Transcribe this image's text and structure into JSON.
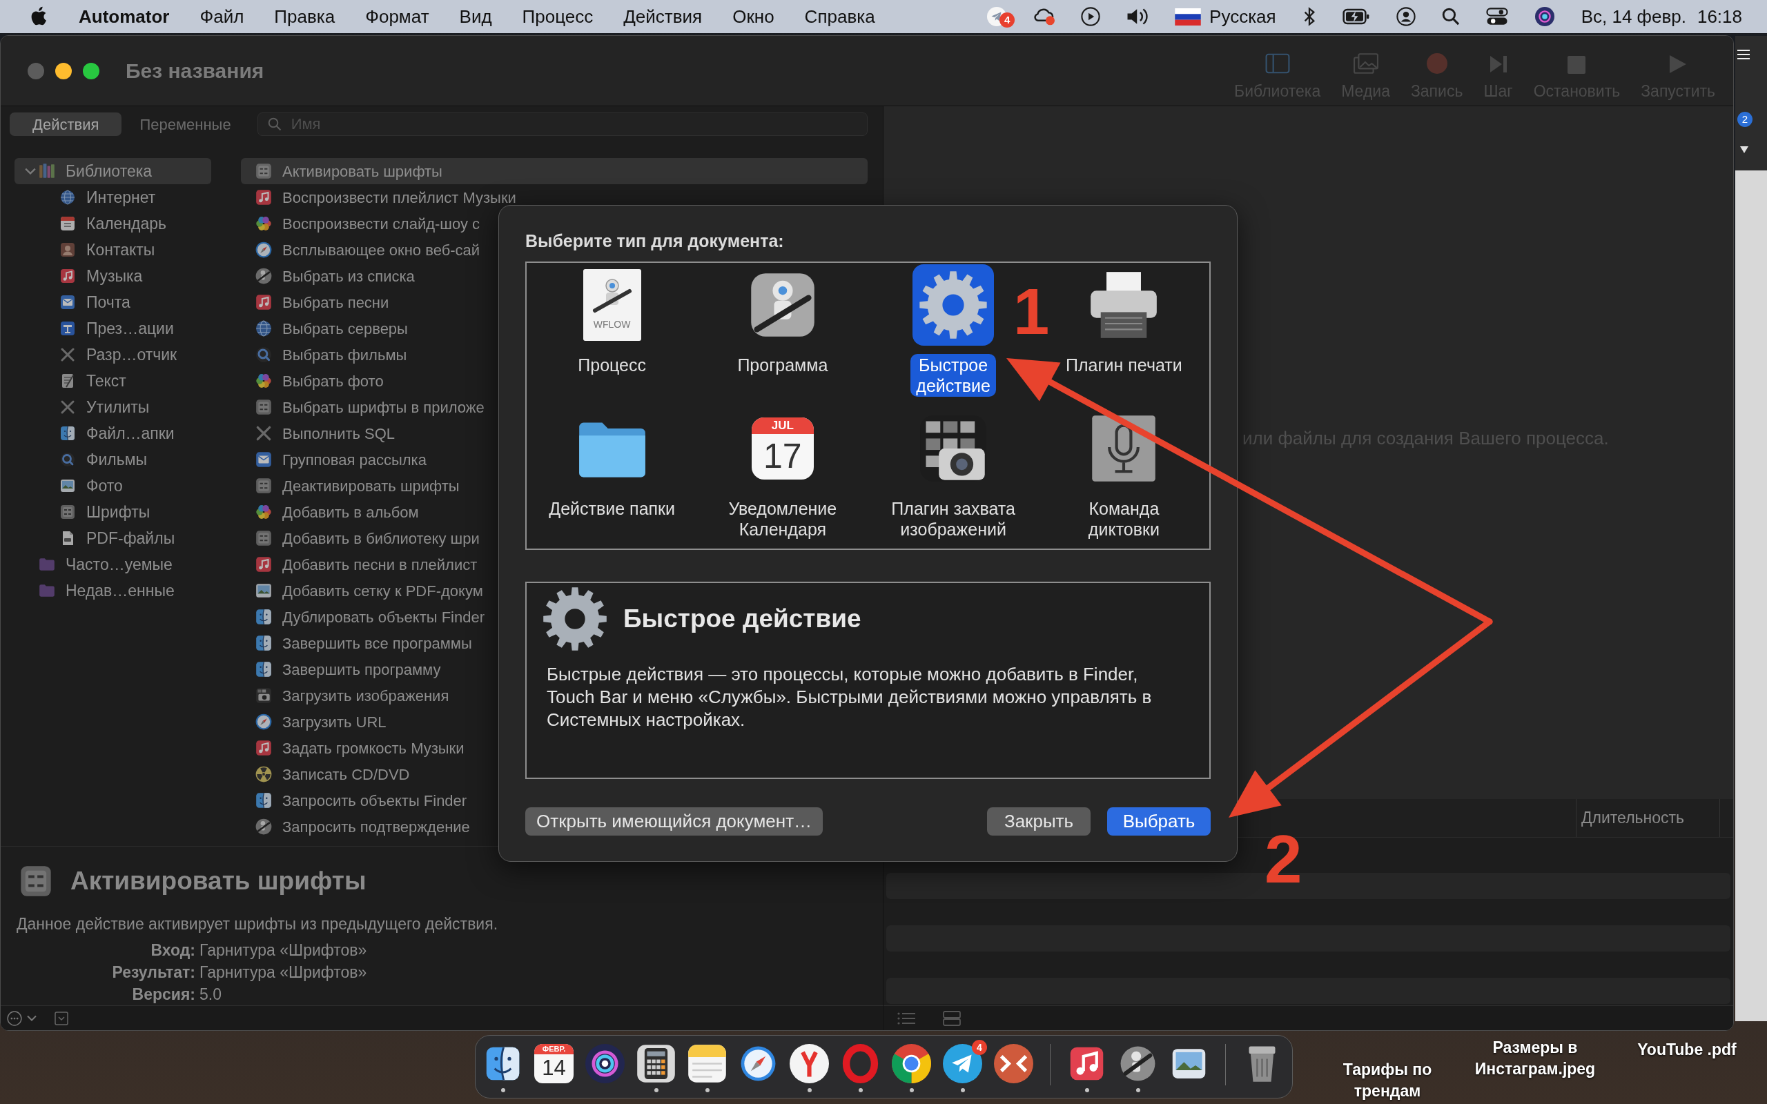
{
  "menu_bar": {
    "app_name": "Automator",
    "menus": [
      "Файл",
      "Правка",
      "Формат",
      "Вид",
      "Процесс",
      "Действия",
      "Окно",
      "Справка"
    ],
    "status_items": [
      {
        "kind": "telegram",
        "badge": "4"
      },
      {
        "kind": "cloud"
      },
      {
        "kind": "play"
      },
      {
        "kind": "volume"
      },
      {
        "kind": "flag",
        "label": "Русская"
      },
      {
        "kind": "bluetooth"
      },
      {
        "kind": "battery"
      },
      {
        "kind": "user"
      },
      {
        "kind": "search"
      },
      {
        "kind": "toggles"
      },
      {
        "kind": "siri"
      }
    ],
    "date": "Вс, 14 февр.",
    "time": "16:18"
  },
  "window": {
    "title": "Без названия",
    "buttons": [
      {
        "kind": "close",
        "disabled": true
      },
      {
        "kind": "minimize",
        "disabled": false
      },
      {
        "kind": "zoom",
        "disabled": false
      }
    ],
    "toolbar": [
      {
        "kind": "library",
        "label": "Библиотека",
        "disabled": true
      },
      {
        "kind": "media",
        "label": "Медиа",
        "disabled": true
      },
      {
        "kind": "record",
        "label": "Запись",
        "disabled": true
      },
      {
        "kind": "step",
        "label": "Шаг",
        "disabled": true
      },
      {
        "kind": "stop",
        "label": "Остановить",
        "disabled": true
      },
      {
        "kind": "run",
        "label": "Запустить",
        "disabled": true
      }
    ]
  },
  "tabs": [
    {
      "label": "Действия",
      "selected": true
    },
    {
      "label": "Переменные",
      "selected": false
    }
  ],
  "search": {
    "placeholder": "Имя"
  },
  "library": [
    {
      "label": "Библиотека",
      "kind": "books",
      "expanded": true,
      "selected": true,
      "children": [
        {
          "label": "Интернет",
          "kind": "globe",
          "selected": false
        },
        {
          "label": "Календарь",
          "kind": "calendar",
          "selected": false
        },
        {
          "label": "Контакты",
          "kind": "contacts",
          "selected": false
        },
        {
          "label": "Музыка",
          "kind": "music",
          "selected": false
        },
        {
          "label": "Почта",
          "kind": "mail",
          "selected": false
        },
        {
          "label": "През…ации",
          "kind": "podium",
          "selected": false
        },
        {
          "label": "Разр…отчик",
          "kind": "tools",
          "selected": false
        },
        {
          "label": "Текст",
          "kind": "notepad",
          "selected": false
        },
        {
          "label": "Утилиты",
          "kind": "tools",
          "selected": false
        },
        {
          "label": "Файл…апки",
          "kind": "finder",
          "selected": false
        },
        {
          "label": "Фильмы",
          "kind": "lens",
          "selected": false
        },
        {
          "label": "Фото",
          "kind": "landscape",
          "selected": false
        },
        {
          "label": "Шрифты",
          "kind": "fonts",
          "selected": false
        },
        {
          "label": "PDF-файлы",
          "kind": "document",
          "selected": false
        }
      ]
    },
    {
      "label": "Часто…уемые",
      "kind": "folder",
      "selected": false
    },
    {
      "label": "Недав…енные",
      "kind": "folder",
      "selected": false
    }
  ],
  "actions": [
    {
      "label": "Активировать шрифты",
      "kind": "fonts",
      "selected": true
    },
    {
      "label": "Воспроизвести плейлист Музыки",
      "kind": "music",
      "selected": false
    },
    {
      "label": "Воспроизвести слайд-шоу с",
      "kind": "flower",
      "selected": false
    },
    {
      "label": "Всплывающее окно веб-сай",
      "kind": "compass",
      "selected": false
    },
    {
      "label": "Выбрать из списка",
      "kind": "robot",
      "selected": false
    },
    {
      "label": "Выбрать песни",
      "kind": "music",
      "selected": false
    },
    {
      "label": "Выбрать серверы",
      "kind": "globe",
      "selected": false
    },
    {
      "label": "Выбрать фильмы",
      "kind": "lens",
      "selected": false
    },
    {
      "label": "Выбрать фото",
      "kind": "flower",
      "selected": false
    },
    {
      "label": "Выбрать шрифты в приложе",
      "kind": "fonts",
      "selected": false
    },
    {
      "label": "Выполнить SQL",
      "kind": "tools",
      "selected": false
    },
    {
      "label": "Групповая рассылка",
      "kind": "mail",
      "selected": false
    },
    {
      "label": "Деактивировать шрифты",
      "kind": "fonts",
      "selected": false
    },
    {
      "label": "Добавить в альбом",
      "kind": "flower",
      "selected": false
    },
    {
      "label": "Добавить в библиотеку шри",
      "kind": "fonts",
      "selected": false
    },
    {
      "label": "Добавить песни в плейлист",
      "kind": "music",
      "selected": false
    },
    {
      "label": "Добавить сетку к PDF-докум",
      "kind": "landscape",
      "selected": false
    },
    {
      "label": "Дублировать объекты Finder",
      "kind": "finder",
      "selected": false
    },
    {
      "label": "Завершить все программы",
      "kind": "finder",
      "selected": false
    },
    {
      "label": "Завершить программу",
      "kind": "finder",
      "selected": false
    },
    {
      "label": "Загрузить изображения",
      "kind": "camera",
      "selected": false
    },
    {
      "label": "Загрузить URL",
      "kind": "compass",
      "selected": false
    },
    {
      "label": "Задать громкость Музыки",
      "kind": "music",
      "selected": false
    },
    {
      "label": "Записать CD/DVD",
      "kind": "radiation",
      "selected": false
    },
    {
      "label": "Запросить объекты Finder",
      "kind": "finder",
      "selected": false
    },
    {
      "label": "Запросить подтверждение",
      "kind": "robot",
      "selected": false
    }
  ],
  "action_info": {
    "title": "Активировать шрифты",
    "description": "Данное действие активирует шрифты из предыдущего действия.",
    "fields": [
      {
        "label": "Вход:",
        "value": "Гарнитура «Шрифтов»"
      },
      {
        "label": "Результат:",
        "value": "Гарнитура «Шрифтов»"
      },
      {
        "label": "Версия:",
        "value": "5.0"
      }
    ]
  },
  "workflow": {
    "hint": "или файлы для создания Вашего процесса.",
    "log_columns": [
      "Длительность"
    ]
  },
  "dialog": {
    "title": "Выберите тип для документа:",
    "types": [
      {
        "label": "Процесс",
        "kind": "workflow",
        "icon_text": "WFLOW",
        "selected": false
      },
      {
        "label": "Программа",
        "kind": "application",
        "selected": false
      },
      {
        "label": "Быстрое\nдействие",
        "kind": "gear",
        "selected": true
      },
      {
        "label": "Плагин печати",
        "kind": "printer",
        "selected": false
      },
      {
        "label": "Действие папки",
        "kind": "folder",
        "selected": false
      },
      {
        "label": "Уведомление\nКалендаря",
        "kind": "calendar",
        "icon_month": "JUL",
        "icon_day": "17",
        "selected": false
      },
      {
        "label": "Плагин захвата\nизображений",
        "kind": "camera",
        "selected": false
      },
      {
        "label": "Команда\nдиктовки",
        "kind": "microphone",
        "selected": false
      }
    ],
    "detail": {
      "title": "Быстрое действие",
      "text": "Быстрые действия — это процессы, которые можно добавить в Finder, Touch Bar и меню «Службы». Быстрыми действиями можно управлять в Системных настройках."
    },
    "open_button": {
      "label": "Открыть имеющийся документ…"
    },
    "buttons": [
      {
        "label": "Закрыть",
        "kind": "default"
      },
      {
        "label": "Выбрать",
        "kind": "primary"
      }
    ]
  },
  "annotations": [
    {
      "label": "1"
    },
    {
      "label": "2"
    }
  ],
  "background_window": {
    "badge": "2"
  },
  "dock": [
    {
      "kind": "finder",
      "running": true
    },
    {
      "kind": "calendar",
      "month": "ФЕВР.",
      "day": "14",
      "running": false
    },
    {
      "kind": "orb",
      "running": false
    },
    {
      "kind": "calculator",
      "running": true
    },
    {
      "kind": "notes",
      "running": true
    },
    {
      "kind": "compass",
      "running": false
    },
    {
      "kind": "ymark",
      "running": true
    },
    {
      "kind": "ring",
      "running": true
    },
    {
      "kind": "segments",
      "running": true
    },
    {
      "kind": "plane",
      "badge": "4",
      "running": true
    },
    {
      "kind": "chevrons",
      "running": false
    },
    {
      "kind": "separator"
    },
    {
      "kind": "music",
      "running": true
    },
    {
      "kind": "robot",
      "running": true
    },
    {
      "kind": "landscape",
      "running": false
    },
    {
      "kind": "separator"
    },
    {
      "kind": "trash",
      "running": false
    }
  ],
  "desktop_files": [
    {
      "name": "Тарифы по трендам"
    },
    {
      "name": "Размеры в Инстаграм.jpeg"
    },
    {
      "name": "YouTube .pdf"
    }
  ]
}
